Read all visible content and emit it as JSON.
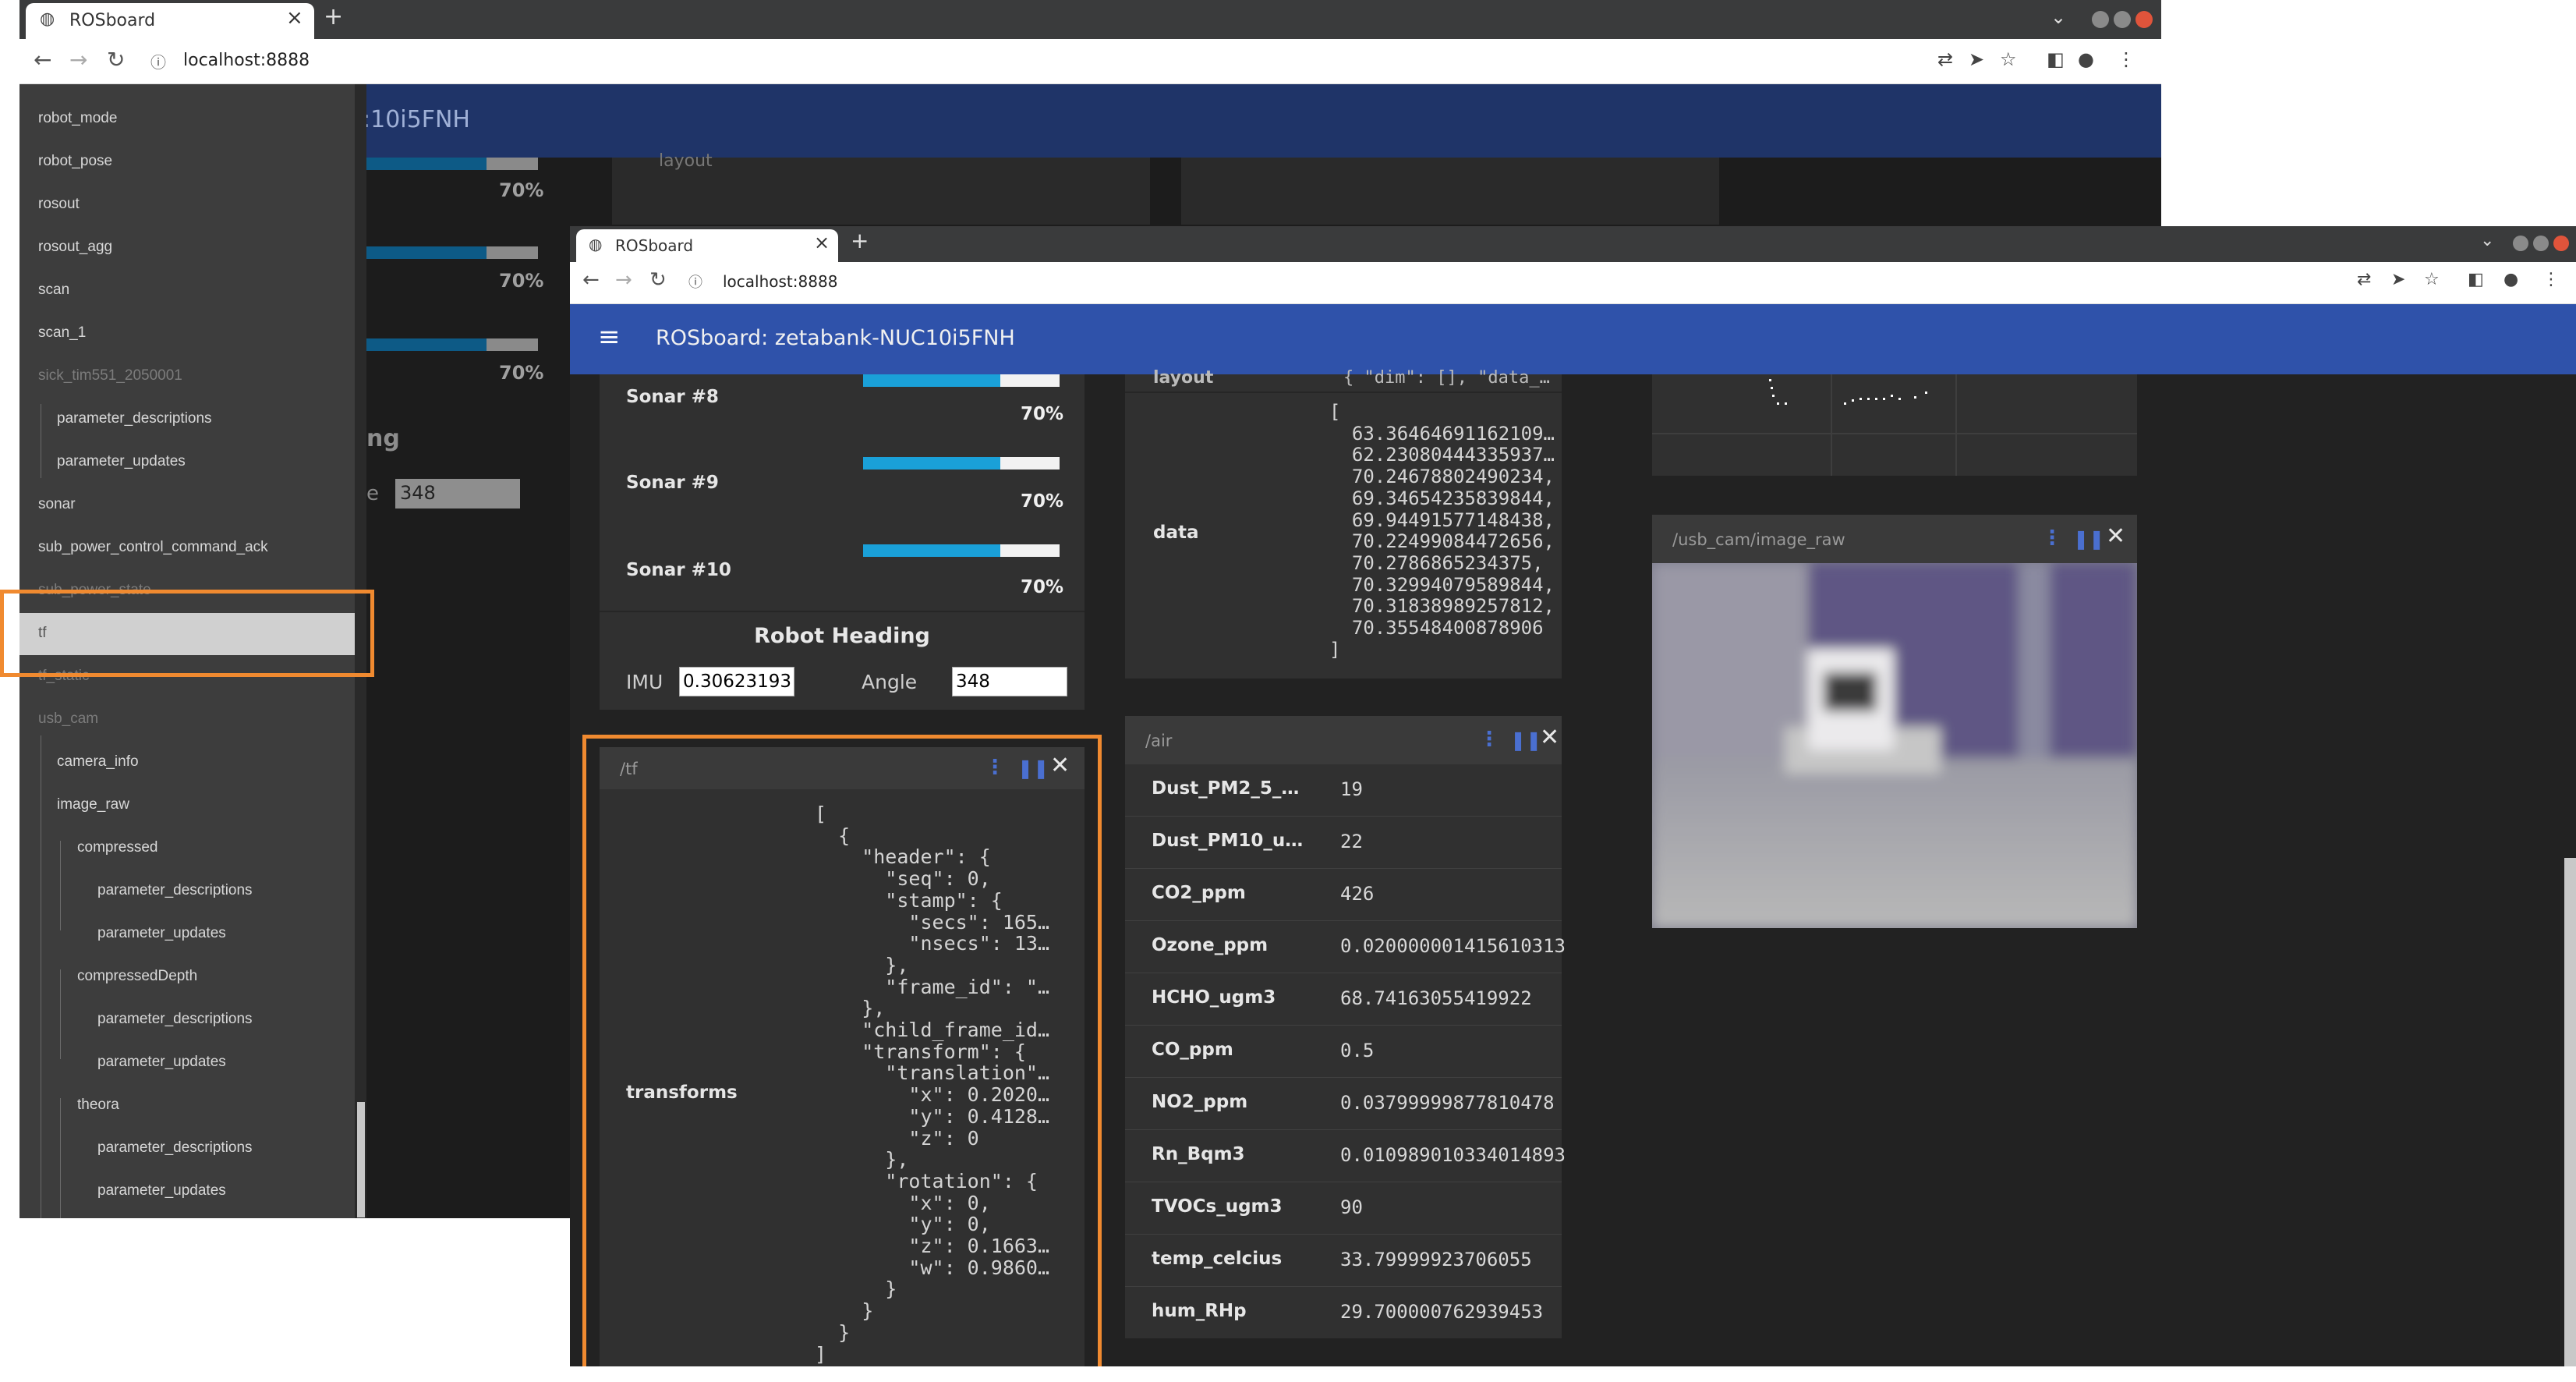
{
  "back_window": {
    "tab_title": "ROSboard",
    "url": "localhost:8888",
    "header_fragment": ":10i5FNH",
    "percents": [
      "70%",
      "70%",
      "70%"
    ],
    "heading_fragment": "ng",
    "angle_fragment": "e",
    "angle_value": "348",
    "layout_fragment": "layout",
    "sidebar": {
      "items": [
        {
          "label": "robot_mode"
        },
        {
          "label": "robot_pose"
        },
        {
          "label": "rosout"
        },
        {
          "label": "rosout_agg"
        },
        {
          "label": "scan"
        },
        {
          "label": "scan_1"
        },
        {
          "label": "sick_tim551_2050001"
        },
        {
          "label": "parameter_descriptions"
        },
        {
          "label": "parameter_updates"
        },
        {
          "label": "sonar"
        },
        {
          "label": "sub_power_control_command_ack"
        },
        {
          "label": "sub_power_state"
        },
        {
          "label": "tf"
        },
        {
          "label": "tf_static"
        },
        {
          "label": "usb_cam"
        },
        {
          "label": "camera_info"
        },
        {
          "label": "image_raw"
        },
        {
          "label": "compressed"
        },
        {
          "label": "parameter_descriptions"
        },
        {
          "label": "parameter_updates"
        },
        {
          "label": "compressedDepth"
        },
        {
          "label": "parameter_descriptions"
        },
        {
          "label": "parameter_updates"
        },
        {
          "label": "theora"
        },
        {
          "label": "parameter_descriptions"
        },
        {
          "label": "parameter_updates"
        }
      ]
    }
  },
  "front_window": {
    "tab_title": "ROSboard",
    "url": "localhost:8888",
    "header_title": "ROSboard: zetabank-NUC10i5FNH",
    "sonar_card": {
      "rows": [
        {
          "label": "Sonar #8",
          "percent": "70%",
          "fill": 0.7
        },
        {
          "label": "Sonar #9",
          "percent": "70%",
          "fill": 0.7
        },
        {
          "label": "Sonar #10",
          "percent": "70%",
          "fill": 0.7
        }
      ],
      "heading_title": "Robot Heading",
      "imu_label": "IMU",
      "imu_value": "0.30623193",
      "angle_label": "Angle",
      "angle_value": "348"
    },
    "tf_card": {
      "topic": "/tf",
      "field": "transforms",
      "json": "[\n  {\n    \"header\": {\n      \"seq\": 0,\n      \"stamp\": {\n        \"secs\": 165…\n        \"nsecs\": 13…\n      },\n      \"frame_id\": \"…\n    },\n    \"child_frame_id…\n    \"transform\": {\n      \"translation\"…\n        \"x\": 0.2020…\n        \"y\": 0.4128…\n        \"z\": 0\n      },\n      \"rotation\": {\n        \"x\": 0,\n        \"y\": 0,\n        \"z\": 0.1663…\n        \"w\": 0.9860…\n      }\n    }\n  }\n]"
    },
    "array_card": {
      "layout_label": "layout",
      "layout_value": "{ \"dim\": [], \"data_…",
      "data_label": "data",
      "data_values": "[\n  63.36464691162109…\n  62.23080444335937…\n  70.24678802490234,\n  69.34654235839844,\n  69.94491577148438,\n  70.22499084472656,\n  70.2786865234375,\n  70.32994079589844,\n  70.31838989257812,\n  70.35548400878906\n]"
    },
    "air_card": {
      "topic": "/air",
      "rows": [
        {
          "label": "Dust_PM2_5_…",
          "value": "19"
        },
        {
          "label": "Dust_PM10_u…",
          "value": "22"
        },
        {
          "label": "CO2_ppm",
          "value": "426"
        },
        {
          "label": "Ozone_ppm",
          "value": "0.020000001415610313"
        },
        {
          "label": "HCHO_ugm3",
          "value": "68.74163055419922"
        },
        {
          "label": "CO_ppm",
          "value": "0.5"
        },
        {
          "label": "NO2_ppm",
          "value": "0.03799999877810478"
        },
        {
          "label": "Rn_Bqm3",
          "value": "0.010989010334014893"
        },
        {
          "label": "TVOCs_ugm3",
          "value": "90"
        },
        {
          "label": "temp_celcius",
          "value": "33.79999923706055"
        },
        {
          "label": "hum_RHp",
          "value": "29.700000762939453"
        }
      ]
    },
    "image_card": {
      "topic": "/usb_cam/image_raw"
    }
  },
  "colors": {
    "highlight": "#f08a30",
    "header_front": "#2f52aa",
    "header_back": "#1f3468",
    "bar_fill": "#1aa0d8"
  }
}
